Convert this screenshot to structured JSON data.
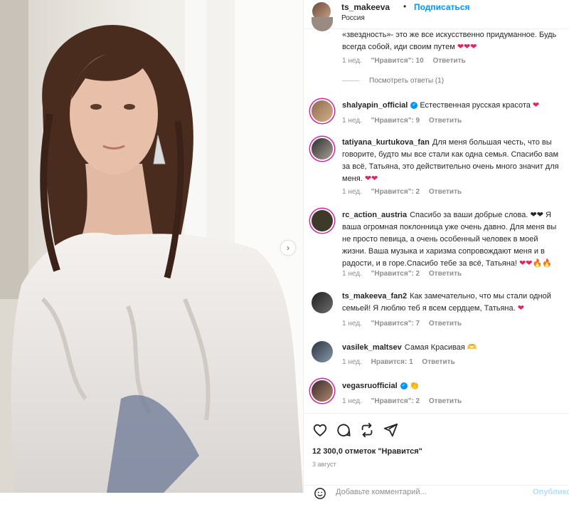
{
  "header": {
    "username": "ts_makeeva",
    "separator": "•",
    "follow_label": "Подписаться",
    "location": "Россия"
  },
  "carousel": {
    "next_glyph": "›"
  },
  "comments": [
    {
      "username": "",
      "text": "«звездность»- это же все искусственно придуманное. Будь всегда собой, иди своим путем",
      "emoji": "❤❤❤",
      "time": "1 нед.",
      "likes": "\"Нравится\": 10",
      "reply": "Ответить",
      "view_replies": "Посмотреть ответы (1)"
    },
    {
      "username": "shalyapin_official",
      "text": "Естественная русская красота",
      "emoji": "❤",
      "time": "1 нед.",
      "likes": "\"Нравится\": 9",
      "reply": "Ответить"
    },
    {
      "username": "tatiyana_kurtukova_fan",
      "text": "Для меня большая честь, что вы говорите, будто мы все стали как одна семья. Спасибо вам за всё, Татьяна, это действительно очень много значит для меня.",
      "emoji": "❤❤",
      "time": "1 нед.",
      "likes": "\"Нравится\": 2",
      "reply": "Ответить"
    },
    {
      "username": "rc_action_austria",
      "text": "Спасибо за ваши добрые слова. ❤❤ Я ваша огромная поклонница уже очень давно. Для меня вы не просто певица, а очень особенный человек в моей жизни. Ваша музыка и харизма сопровождают меня и в радости, и в горе.Спасибо тебе за всё, Татьяна!",
      "emoji": "❤❤🔥🔥",
      "time": "1 нед.",
      "likes": "\"Нравится\": 2",
      "reply": "Ответить"
    },
    {
      "username": "ts_makeeva_fan2",
      "text": "Как замечательно, что мы стали одной семьей! Я люблю теб я всем сердцем, Татьяна.",
      "emoji": "❤",
      "time": "1 нед.",
      "likes": "\"Нравится\": 7",
      "reply": "Ответить"
    },
    {
      "username": "vasilek_maltsev",
      "text": "Самая Красивая",
      "emoji": "🫶",
      "time": "1 нед.",
      "likes": "Нравится: 1",
      "reply": "Ответить"
    },
    {
      "username": "vegasruofficial",
      "text": "",
      "emoji": "👏",
      "time": "1 нед.",
      "likes": "\"Нравится\": 2",
      "reply": "Ответить"
    }
  ],
  "verified_mark": "✓",
  "actions": {
    "likes_count": "12 300,0 отметок \"Нравится\"",
    "date": "3 август",
    "add_comment_placeholder": "Добавьте комментарий...",
    "publish_label": "Опубликовать"
  },
  "colors": {
    "accent": "#0095f6",
    "heart": "#e0245e"
  }
}
